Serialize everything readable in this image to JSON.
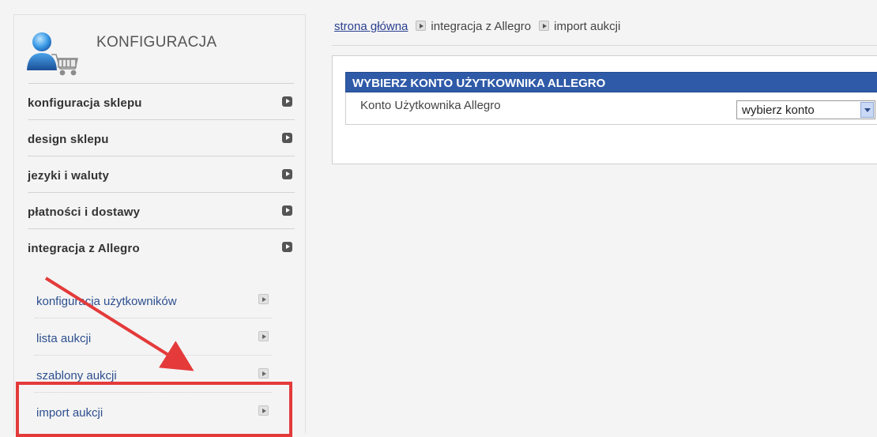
{
  "sidebar": {
    "title": "KONFIGURACJA",
    "menu": [
      {
        "label": "konfiguracja sklepu"
      },
      {
        "label": "design sklepu"
      },
      {
        "label": "jezyki i waluty"
      },
      {
        "label": "płatności i dostawy"
      },
      {
        "label": "integracja z Allegro"
      }
    ],
    "submenu": [
      {
        "label": "konfiguracja użytkowników"
      },
      {
        "label": "lista aukcji"
      },
      {
        "label": "szablony aukcji"
      },
      {
        "label": "import aukcji"
      }
    ]
  },
  "breadcrumb": {
    "home": "strona główna",
    "items": [
      "integracja z Allegro",
      "import aukcji"
    ]
  },
  "panel": {
    "title": "WYBIERZ KONTO UŻYTKOWNIKA ALLEGRO",
    "field_label": "Konto Użytkownika Allegro",
    "select_value": "wybierz konto"
  },
  "colors": {
    "panel_header": "#2f5aa8",
    "submenu_link": "#2d4f8f",
    "annotation": "#e43a3a"
  },
  "icons": [
    "user-cart-icon",
    "arrow-right-icon",
    "dropdown-arrow-icon"
  ]
}
